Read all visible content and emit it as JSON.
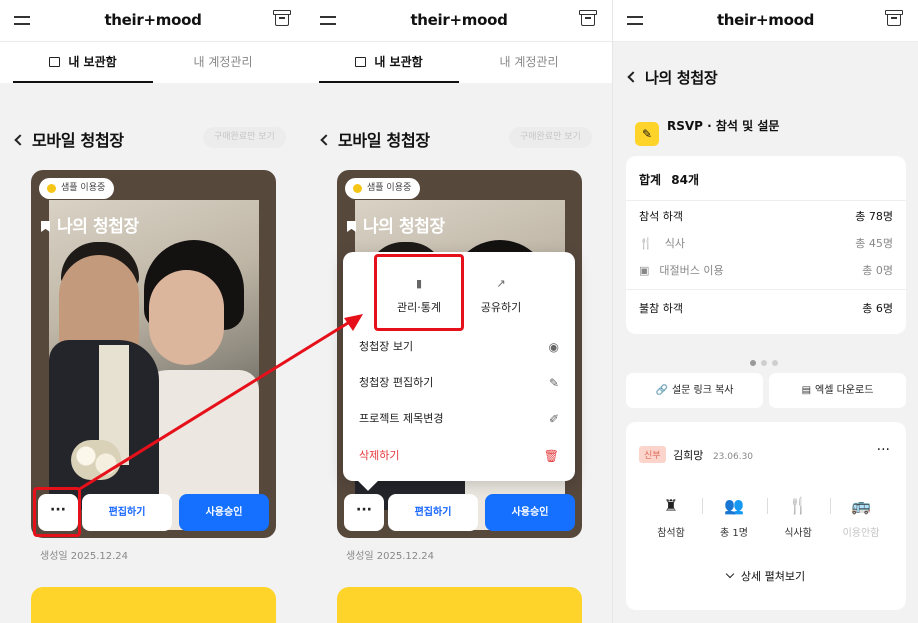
{
  "brand": "their+mood",
  "tabs": {
    "vault": "내 보관함",
    "account": "내 계정관리"
  },
  "section_title": "모바일 청첩장",
  "filter_pill": "구매완료만 보기",
  "card": {
    "badge": "샘플 이용중",
    "title": "나의 청첩장",
    "more": "···",
    "edit": "편집하기",
    "approve": "사용승인",
    "created": "생성일 2025.12.24"
  },
  "popup": {
    "stats": "관리·통계",
    "share": "공유하기",
    "items": [
      "청첩장 보기",
      "청첩장 편집하기",
      "프로젝트 제목변경",
      "삭제하기"
    ]
  },
  "detail": {
    "back_title": "나의 청첩장",
    "rsvp_title": "RSVP · 참석 및 설문",
    "total_label": "합계",
    "total_value": "84개",
    "attend_label": "참석 하객",
    "attend_value": "총 78명",
    "meal_label": "식사",
    "meal_value": "총 45명",
    "bus_label": "대절버스 이용",
    "bus_value": "총 0명",
    "absent_label": "불참 하객",
    "absent_value": "총 6명",
    "copy_link": "설문 링크 복사",
    "excel": "엑셀 다운로드",
    "guest": {
      "tag": "신부",
      "name": "김희망",
      "date": "23.06.30",
      "more": "···",
      "attend": "참석함",
      "count": "총 1명",
      "meal": "식사함",
      "bus": "이용안함"
    },
    "expand": "상세 펼쳐보기"
  },
  "colors": {
    "accent": "#1570ff",
    "yellow": "#ffd42a",
    "highlight": "#e6101a",
    "danger": "#e5393c"
  }
}
